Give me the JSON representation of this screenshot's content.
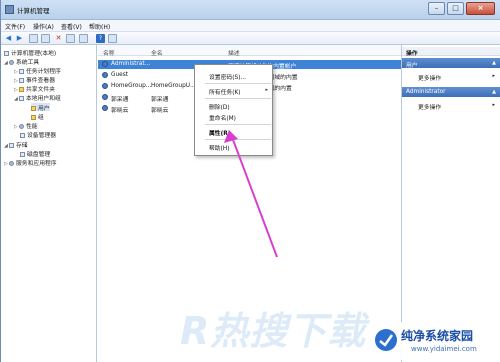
{
  "window": {
    "title": "计算机管理",
    "buttons": [
      "–",
      "□",
      "×"
    ]
  },
  "menubar": {
    "items": [
      "文件(F)",
      "操作(A)",
      "查看(V)",
      "帮助(H)"
    ]
  },
  "toolbar": {
    "help_glyph": "?"
  },
  "tree": {
    "items": [
      {
        "label": "计算机管理(本地)",
        "depth": 0,
        "icon": "computer-icon"
      },
      {
        "label": "系统工具",
        "depth": 1,
        "icon": "tools-icon"
      },
      {
        "label": "任务计划程序",
        "depth": 2,
        "icon": "clock-icon"
      },
      {
        "label": "事件查看器",
        "depth": 2,
        "icon": "event-icon"
      },
      {
        "label": "共享文件夹",
        "depth": 2,
        "icon": "folder-icon"
      },
      {
        "label": "本地用户和组",
        "depth": 2,
        "icon": "users-icon"
      },
      {
        "label": "用户",
        "depth": 3,
        "icon": "folder-icon"
      },
      {
        "label": "组",
        "depth": 3,
        "icon": "folder-icon"
      },
      {
        "label": "性能",
        "depth": 2,
        "icon": "performance-icon"
      },
      {
        "label": "设备管理器",
        "depth": 2,
        "icon": "device-icon"
      },
      {
        "label": "存储",
        "depth": 1,
        "icon": "storage-icon"
      },
      {
        "label": "磁盘管理",
        "depth": 2,
        "icon": "disk-icon"
      },
      {
        "label": "服务和应用程序",
        "depth": 1,
        "icon": "services-icon"
      }
    ]
  },
  "list": {
    "columns": [
      "名称",
      "全名",
      "描述"
    ],
    "rows": [
      {
        "name": "Administrat...",
        "fullname": "",
        "description": "管理计算机(域)的内置帐户",
        "selected": true
      },
      {
        "name": "Guest",
        "fullname": "",
        "description": "访问计算机或访问域的内置",
        "selected": false
      },
      {
        "name": "HomeGroup...",
        "fullname": "HomeGroupU...",
        "description": "家庭组访问计算机的内置",
        "selected": false
      },
      {
        "name": "郭采通",
        "fullname": "郭采通",
        "description": "",
        "selected": false
      },
      {
        "name": "郭晓云",
        "fullname": "郭晓云",
        "description": "",
        "selected": false
      }
    ]
  },
  "context_menu": {
    "items": [
      {
        "label": "设置密码(S)...",
        "bold": false
      },
      {
        "label": "所有任务(K)",
        "bold": false,
        "submenu": "▸"
      },
      {
        "label": "删除(D)",
        "bold": false
      },
      {
        "label": "重命名(M)",
        "bold": false
      },
      {
        "label": "属性(R)",
        "bold": true
      },
      {
        "label": "帮助(H)",
        "bold": false
      }
    ]
  },
  "actions": {
    "header": "操作",
    "sections": [
      {
        "title": "用户",
        "item": "更多操作"
      },
      {
        "title": "Administrator",
        "item": "更多操作"
      }
    ]
  },
  "watermark": {
    "text": "R热搜下载"
  },
  "brand": {
    "name": "纯净系统家园",
    "url": "www.yidaimei.com"
  },
  "colors": {
    "selection": "#3f83d6",
    "arrow": "#d83fd0",
    "accent": "#3d6fb7"
  }
}
